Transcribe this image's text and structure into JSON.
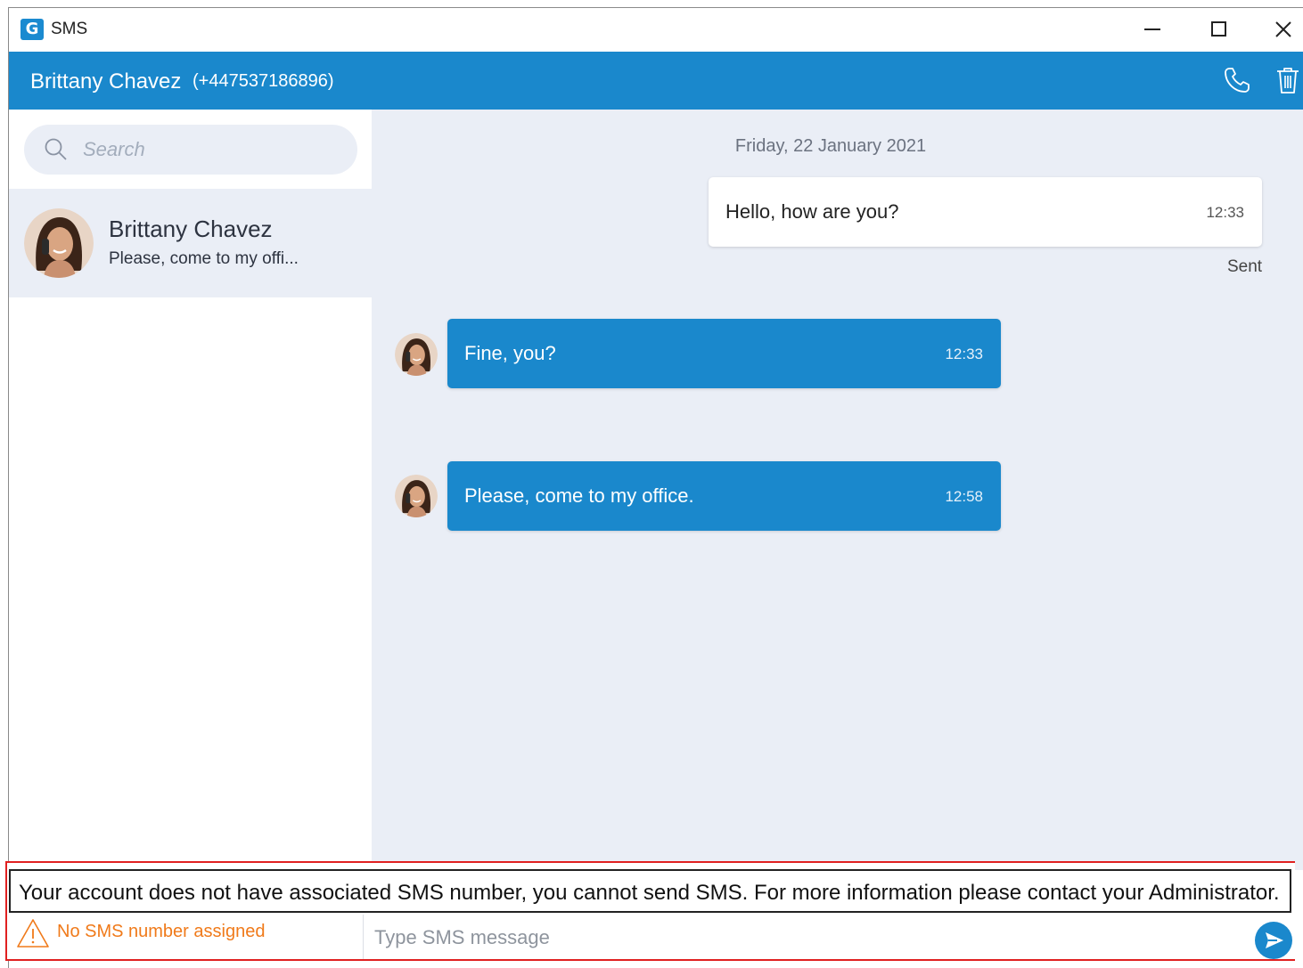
{
  "app": {
    "title": "SMS",
    "logo_letter": "G"
  },
  "window_controls": {
    "minimize_icon": "minimize-icon",
    "maximize_icon": "maximize-icon",
    "close_icon": "close-icon"
  },
  "header": {
    "contact_name": "Brittany Chavez",
    "contact_phone": "(+447537186896)",
    "call_icon": "phone-icon",
    "delete_icon": "trash-icon",
    "background_color": "#1a88cc"
  },
  "sidebar": {
    "search_placeholder": "Search",
    "contacts": [
      {
        "name": "Brittany Chavez",
        "preview": "Please, come to my offi..."
      }
    ]
  },
  "chat": {
    "date": "Friday, 22 January 2021",
    "messages": [
      {
        "direction": "outgoing",
        "text": "Hello, how are you?",
        "time": "12:33",
        "status": "Sent"
      },
      {
        "direction": "incoming",
        "text": "Fine, you?",
        "time": "12:33"
      },
      {
        "direction": "incoming",
        "text": "Please, come to my office.",
        "time": "12:58"
      }
    ]
  },
  "footer": {
    "warning_message": "Your account does not have associated SMS number, you cannot send SMS. For more information please contact your Administrator.",
    "no_sms_label": "No SMS number assigned",
    "no_sms_color": "#f07a1a",
    "compose_placeholder": "Type SMS message",
    "send_icon": "send-icon"
  }
}
